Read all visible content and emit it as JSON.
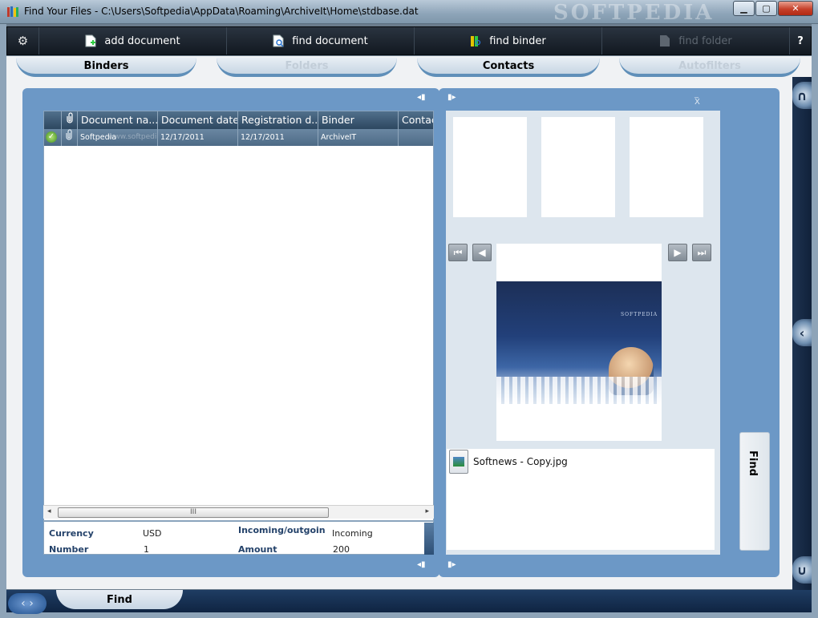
{
  "window": {
    "title": "Find Your Files - C:\\Users\\Softpedia\\AppData\\Roaming\\ArchiveIt\\Home\\stdbase.dat",
    "brand_watermark": "SOFTPEDIA",
    "minimize": "▁",
    "maximize": "▢",
    "close": "✕"
  },
  "toolbar": {
    "gear": "⚙",
    "items": [
      {
        "label": "add document",
        "enabled": true
      },
      {
        "label": "find document",
        "enabled": true
      },
      {
        "label": "find binder",
        "enabled": true
      },
      {
        "label": "find folder",
        "enabled": false
      }
    ],
    "help": "?"
  },
  "tabs": [
    {
      "label": "Binders",
      "active": true
    },
    {
      "label": "Folders",
      "active": false
    },
    {
      "label": "Contacts",
      "active": true
    },
    {
      "label": "Autofilters",
      "active": false
    }
  ],
  "grid": {
    "columns": [
      "Document na...",
      "Document date",
      "Registration d...",
      "Binder",
      "Contac"
    ],
    "rows": [
      {
        "name": "Softpedia",
        "watermark": "www.softpedia.com",
        "document_date": "12/17/2011",
        "registration_date": "12/17/2011",
        "binder": "ArchiveIT",
        "contact": ""
      }
    ],
    "scroll_grip": "III",
    "scroll_left": "◂",
    "scroll_right": "▸"
  },
  "details": {
    "currency_label": "Currency",
    "currency_value": "USD",
    "number_label": "Number",
    "number_value": "1",
    "incoming_label": "Incoming/outgoin",
    "incoming_value": "Incoming",
    "amount_label": "Amount",
    "amount_value": "200"
  },
  "preview": {
    "watermark": "SOFTPEDIA",
    "file_name": "Softnews - Copy.jpg"
  },
  "side": {
    "find_label": "Find"
  },
  "bottom": {
    "tab_label": "Find"
  },
  "colors": {
    "panel_blue": "#6c98c6",
    "toolbar_dark": "#121820",
    "grid_header": "#2d4760"
  }
}
